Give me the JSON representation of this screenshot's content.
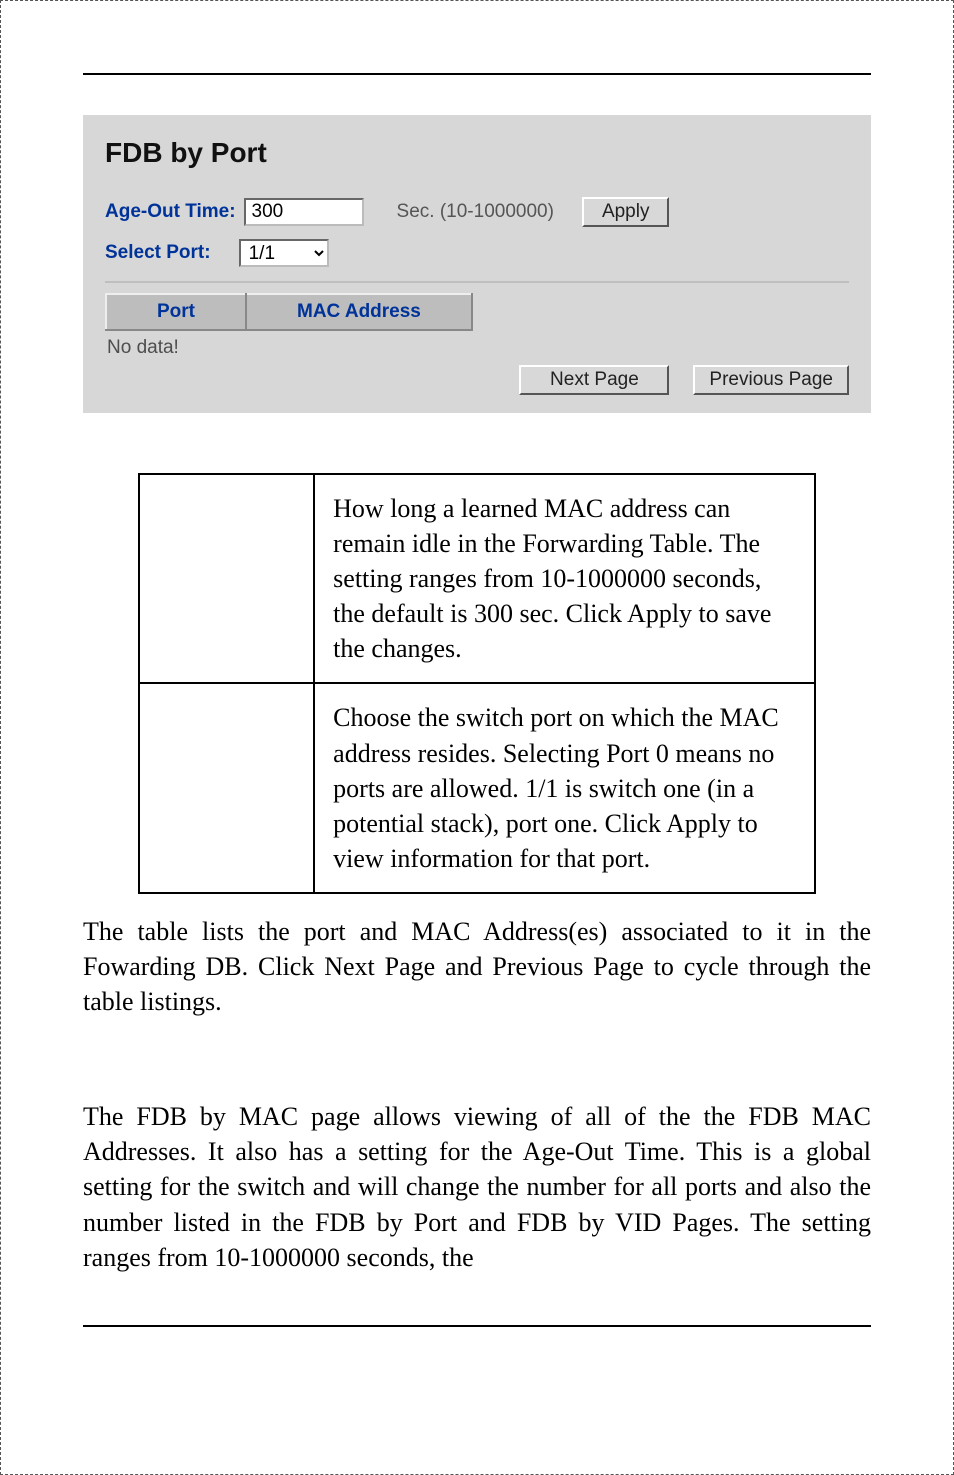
{
  "panel": {
    "title": "FDB by Port",
    "ageOutLabel": "Age-Out Time:",
    "ageOutValue": "300",
    "secRange": "Sec. (10-1000000)",
    "applyLabel": "Apply",
    "selectPortLabel": "Select Port:",
    "selectPortValue": "1/1",
    "tableHeaders": {
      "port": "Port",
      "mac": "MAC Address"
    },
    "noData": "No data!",
    "nextPage": "Next Page",
    "previousPage": "Previous Page"
  },
  "descTable": {
    "rows": [
      {
        "left": "",
        "right": "How long a learned MAC address can remain idle in the Forwarding Table. The setting ranges from 10-1000000 seconds, the default is 300 sec. Click Apply to save the changes."
      },
      {
        "left": "",
        "right": "Choose the switch port on which the MAC address resides. Selecting Port 0 means no ports are allowed. 1/1 is switch one (in a potential stack), port one. Click Apply to view information for that port."
      }
    ]
  },
  "body": {
    "para1": "The table lists the port and MAC Address(es) associated to it in the Fowarding DB. Click Next Page and Previous Page to cycle through the table listings.",
    "para2": "The FDB by MAC page allows viewing of all of the the FDB MAC Addresses.  It also has a setting for the Age-Out Time. This is a global setting for the switch and will change the number for all ports and also the number listed in the FDB by Port and FDB by VID Pages. The setting ranges from 10-1000000 seconds, the"
  }
}
